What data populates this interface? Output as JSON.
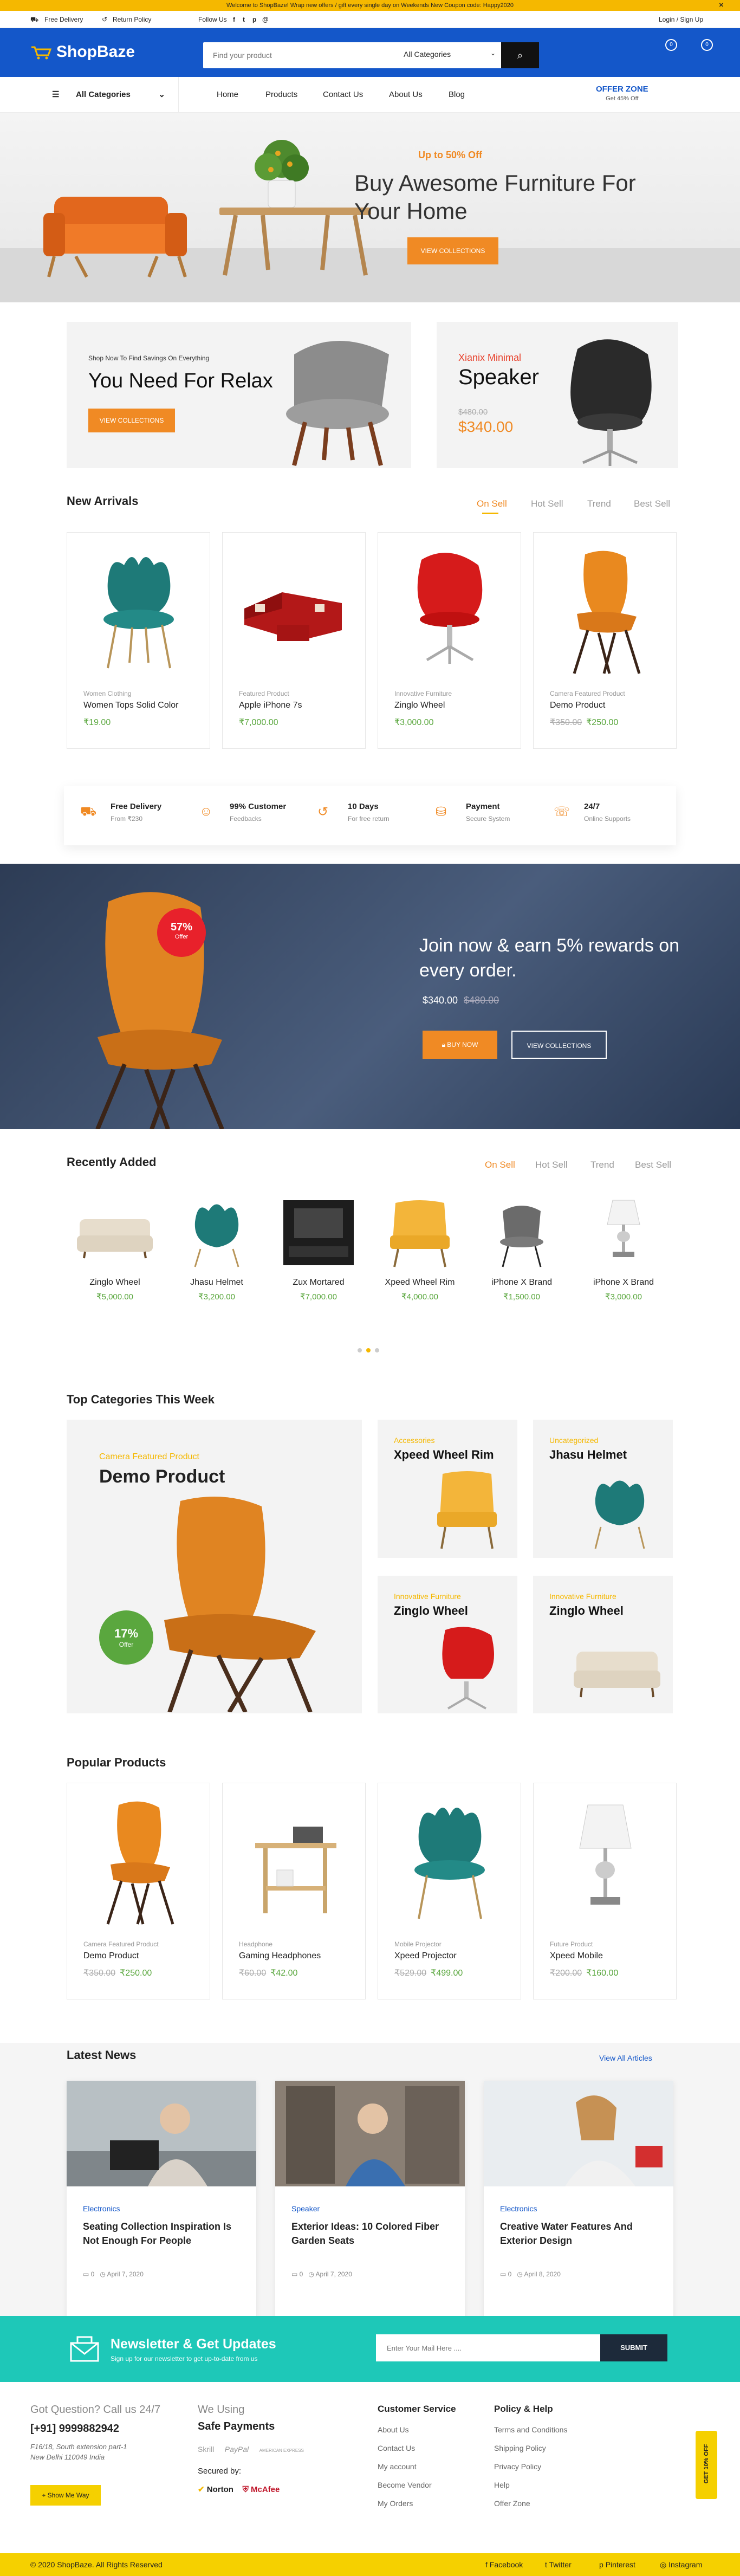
{
  "announce": {
    "text": "Welcome to ShopBaze! Wrap new offers / gift every single day on Weekends New Coupon code: Happy2020",
    "close": "✕"
  },
  "infobar": {
    "free_delivery": "Free Delivery",
    "return_policy": "Return Policy",
    "follow_us": "Follow Us",
    "login": "Login / Sign Up",
    "social": [
      "f",
      "t",
      "p",
      "@"
    ]
  },
  "header": {
    "logo": "ShopBaze",
    "search_placeholder": "Find your product",
    "search_category": "All Categories",
    "wishlist_count": "0",
    "cart_count": "0"
  },
  "nav": {
    "all_categories": "All Categories",
    "items": [
      "Home",
      "Products",
      "Contact Us",
      "About Us",
      "Blog"
    ],
    "offer_title": "OFFER ZONE",
    "offer_sub": "Get 45% Off"
  },
  "hero": {
    "tag": "Up to 50% Off",
    "title": "Buy Awesome Furniture For Your Home",
    "button": "VIEW COLLECTIONS"
  },
  "banner1": {
    "sub": "Shop Now To Find Savings On Everything",
    "title": "You Need For Relax",
    "button": "VIEW COLLECTIONS"
  },
  "banner2": {
    "sub": "Xianix Minimal",
    "title": "Speaker",
    "old_price": "$480.00",
    "price": "$340.00"
  },
  "new_arrivals": {
    "title": "New Arrivals",
    "tabs": [
      "On Sell",
      "Hot Sell",
      "Trend",
      "Best Sell"
    ],
    "products": [
      {
        "cat": "Women Clothing",
        "name": "Women Tops Solid Color",
        "old": "",
        "price": "₹19.00"
      },
      {
        "cat": "Featured Product",
        "name": "Apple iPhone 7s",
        "old": "",
        "price": "₹7,000.00"
      },
      {
        "cat": "Innovative Furniture",
        "name": "Zinglo Wheel",
        "old": "",
        "price": "₹3,000.00"
      },
      {
        "cat": "Camera Featured Product",
        "name": "Demo Product",
        "old": "₹350.00",
        "price": "₹250.00"
      }
    ]
  },
  "features": [
    {
      "icon": "truck-icon",
      "title": "Free Delivery",
      "sub": "From ₹230"
    },
    {
      "icon": "feedback-icon",
      "title": "99% Customer",
      "sub": "Feedbacks"
    },
    {
      "icon": "return-icon",
      "title": "10 Days",
      "sub": "For free return"
    },
    {
      "icon": "payment-icon",
      "title": "Payment",
      "sub": "Secure System"
    },
    {
      "icon": "support-icon",
      "title": "24/7",
      "sub": "Online Supports"
    }
  ],
  "promo": {
    "badge_pct": "57%",
    "badge_off": "Offer",
    "title": "Join now & earn 5% rewards on every order.",
    "price": "$340.00",
    "old_price": "$480.00",
    "buy": "BUY NOW",
    "view": "VIEW COLLECTIONS"
  },
  "recently": {
    "title": "Recently Added",
    "tabs": [
      "On Sell",
      "Hot Sell",
      "Trend",
      "Best Sell"
    ],
    "items": [
      {
        "name": "Zinglo Wheel",
        "price": "₹5,000.00"
      },
      {
        "name": "Jhasu Helmet",
        "price": "₹3,200.00"
      },
      {
        "name": "Zux Mortared",
        "price": "₹7,000.00"
      },
      {
        "name": "Xpeed Wheel Rim",
        "price": "₹4,000.00"
      },
      {
        "name": "iPhone X Brand",
        "price": "₹1,500.00"
      },
      {
        "name": "iPhone X Brand",
        "price": "₹3,000.00"
      }
    ]
  },
  "top_categories": {
    "title": "Top Categories This Week",
    "main": {
      "sub": "Camera Featured Product",
      "title": "Demo Product",
      "badge_pct": "17%",
      "badge_off": "Offer"
    },
    "boxes": [
      {
        "sub": "Accessories",
        "title": "Xpeed Wheel Rim"
      },
      {
        "sub": "Uncategorized",
        "title": "Jhasu Helmet"
      },
      {
        "sub": "Innovative Furniture",
        "title": "Zinglo Wheel"
      },
      {
        "sub": "Innovative Furniture",
        "title": "Zinglo Wheel"
      }
    ]
  },
  "popular": {
    "title": "Popular Products",
    "products": [
      {
        "cat": "Camera Featured Product",
        "name": "Demo Product",
        "old": "₹350.00",
        "price": "₹250.00"
      },
      {
        "cat": "Headphone",
        "name": "Gaming Headphones",
        "old": "₹60.00",
        "price": "₹42.00"
      },
      {
        "cat": "Mobile Projector",
        "name": "Xpeed Projector",
        "old": "₹529.00",
        "price": "₹499.00"
      },
      {
        "cat": "Future Product",
        "name": "Xpeed Mobile",
        "old": "₹200.00",
        "price": "₹160.00"
      }
    ]
  },
  "news": {
    "title": "Latest News",
    "view_all": "View All Articles",
    "items": [
      {
        "cat": "Electronics",
        "title": "Seating Collection Inspiration Is Not Enough For People",
        "comments": "0",
        "date": "April 7, 2020"
      },
      {
        "cat": "Speaker",
        "title": "Exterior Ideas: 10 Colored Fiber Garden Seats",
        "comments": "0",
        "date": "April 7, 2020"
      },
      {
        "cat": "Electronics",
        "title": "Creative Water Features And Exterior Design",
        "comments": "0",
        "date": "April 8, 2020"
      }
    ]
  },
  "newsletter": {
    "title": "Newsletter & Get Updates",
    "sub": "Sign up for our newsletter to get up-to-date from us",
    "placeholder": "Enter Your Mail Here ....",
    "button": "SUBMIT"
  },
  "footer": {
    "q": "Got Question? Call us 24/7",
    "phone": "[+91] 9999882942",
    "addr1": "F16/18, South extension part-1",
    "addr2": "New Delhi 110049 India",
    "directions": "Show Me Way",
    "safe_pre": "We Using",
    "safe": "Safe Payments",
    "pay": [
      "Skrill",
      "PayPal",
      "AMERICAN EXPRESS"
    ],
    "secured": "Secured by:",
    "secure_brands": [
      "Norton",
      "McAfee"
    ],
    "cs_title": "Customer Service",
    "cs": [
      "About Us",
      "Contact Us",
      "My account",
      "Become Vendor",
      "My Orders"
    ],
    "ph_title": "Policy & Help",
    "ph": [
      "Terms and Conditions",
      "Shipping Policy",
      "Privacy Policy",
      "Help",
      "Offer Zone"
    ],
    "side_tab": "GET 10% OFF"
  },
  "bottom": {
    "copy": "© 2020 ShopBaze. All Rights Reserved",
    "social": [
      "Facebook",
      "Twitter",
      "Pinterest",
      "Instagram"
    ]
  },
  "colors": {
    "brand": "#1457c9",
    "accent": "#f08a24",
    "yellow": "#f5b800",
    "price": "#5aa73e",
    "teal": "#1ec8b8"
  }
}
